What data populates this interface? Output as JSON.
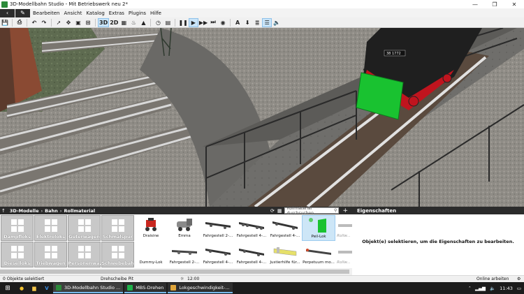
{
  "window": {
    "title": "3D-Modellbahn Studio - Mit Betriebswerk neu 2*",
    "minimize": "—",
    "maximize": "❐",
    "close": "✕"
  },
  "menu": {
    "back_icon": "‹",
    "pen_icon": "✎",
    "items": [
      "Bearbeiten",
      "Ansicht",
      "Katalog",
      "Extras",
      "Plugins",
      "Hilfe"
    ]
  },
  "toolbar": {
    "btn_3d": "3D",
    "btn_2d": "2D",
    "btn_text": "A"
  },
  "viewport": {
    "loco_number": "38 1772"
  },
  "catalog": {
    "breadcrumb": [
      "3D-Modelle",
      "Bahn",
      "Rollmaterial"
    ],
    "search_placeholder": "Rollmaterial durchsuchen",
    "categories": [
      "Dampfloks",
      "Elektroloks",
      "Güterwagen",
      "Schmalspur",
      "Dieselloks",
      "Triebwagen",
      "Personenwa...",
      "Schwebebahn"
    ],
    "items_row1": [
      "Draisine",
      "Emma",
      "Fahrgestell 2-...",
      "Fahrgestell 4-...",
      "Fahrgestell 4-...",
      "Peil-Lok",
      "Rollw..."
    ],
    "items_row2": [
      "Dummy-Lok",
      "Fahrgestell 2-...",
      "Fahrgestell 4-...",
      "Fahrgestell 4-...",
      "Justierhilfe für...",
      "Perpetuum mo...",
      "Rollw..."
    ]
  },
  "properties": {
    "header": "Eigenschaften",
    "placeholder": "Objekt(e) selektieren, um die Eigenschaften zu bearbeiten."
  },
  "status": {
    "selection": "0 Objekte selektiert",
    "object": "Drehscheibe Pit",
    "time": "12:00",
    "mode": "Online arbeiten"
  },
  "taskbar": {
    "apps": [
      "3D-Modellbahn Studio ...",
      "MBS-Drehen",
      "Lokgeschwindigkeit-..."
    ],
    "clock": "11:43"
  },
  "colors": {
    "accent": "#2b2b2b",
    "selection": "#cde6f7",
    "peil_green": "#19c230",
    "loco_red": "#c0141e"
  }
}
